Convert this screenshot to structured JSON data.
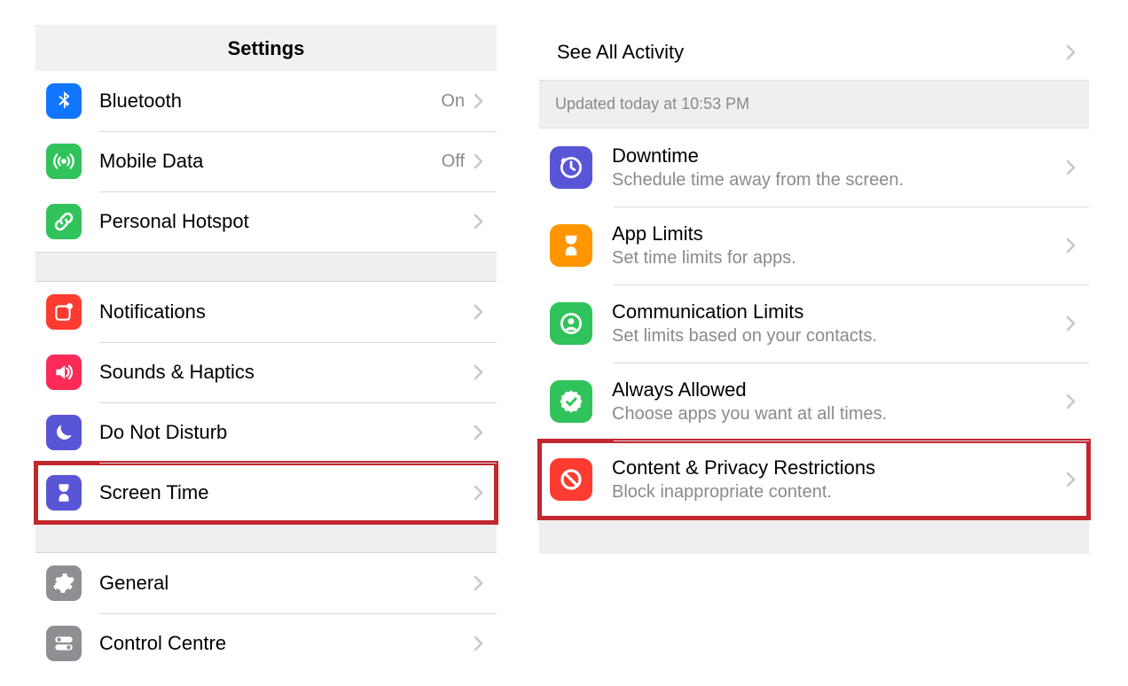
{
  "left": {
    "header": "Settings",
    "group1": [
      {
        "label": "Bluetooth",
        "value": "On"
      },
      {
        "label": "Mobile Data",
        "value": "Off"
      },
      {
        "label": "Personal Hotspot",
        "value": ""
      }
    ],
    "group2": [
      {
        "label": "Notifications"
      },
      {
        "label": "Sounds & Haptics"
      },
      {
        "label": "Do Not Disturb"
      },
      {
        "label": "Screen Time"
      }
    ],
    "group3": [
      {
        "label": "General"
      },
      {
        "label": "Control Centre"
      }
    ]
  },
  "right": {
    "see_all": "See All Activity",
    "updated": "Updated today at 10:53 PM",
    "items": [
      {
        "title": "Downtime",
        "subtitle": "Schedule time away from the screen."
      },
      {
        "title": "App Limits",
        "subtitle": "Set time limits for apps."
      },
      {
        "title": "Communication Limits",
        "subtitle": "Set limits based on your contacts."
      },
      {
        "title": "Always Allowed",
        "subtitle": "Choose apps you want at all times."
      },
      {
        "title": "Content & Privacy Restrictions",
        "subtitle": "Block inappropriate content."
      }
    ]
  }
}
